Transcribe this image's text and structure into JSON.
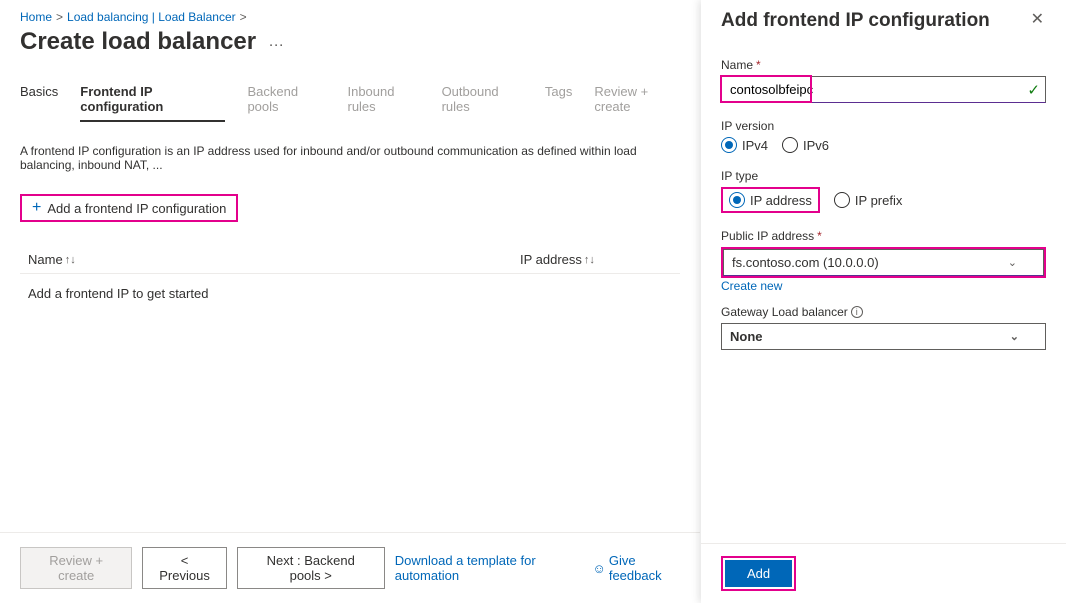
{
  "breadcrumb": {
    "items": [
      "Home",
      "Load balancing | Load Balancer"
    ]
  },
  "page": {
    "title": "Create load balancer"
  },
  "tabs": {
    "items": [
      {
        "label": "Basics"
      },
      {
        "label": "Frontend IP configuration"
      },
      {
        "label": "Backend pools"
      },
      {
        "label": "Inbound rules"
      },
      {
        "label": "Outbound rules"
      },
      {
        "label": "Tags"
      },
      {
        "label": "Review + create"
      }
    ]
  },
  "description": "A frontend IP configuration is an IP address used for inbound and/or outbound communication as defined within load balancing, inbound NAT, ...",
  "add_button": {
    "label": "Add a frontend IP configuration"
  },
  "table": {
    "headers": [
      "Name",
      "IP address"
    ],
    "empty_text": "Add a frontend IP to get started"
  },
  "footer": {
    "review": "Review + create",
    "previous": "< Previous",
    "next": "Next : Backend pools >",
    "download": "Download a template for automation",
    "feedback": "Give feedback"
  },
  "panel": {
    "title": "Add frontend IP configuration",
    "name": {
      "label": "Name",
      "value": "contosolbfeipc"
    },
    "ip_version": {
      "label": "IP version",
      "options": [
        "IPv4",
        "IPv6"
      ],
      "selected": "IPv4"
    },
    "ip_type": {
      "label": "IP type",
      "options": [
        "IP address",
        "IP prefix"
      ],
      "selected": "IP address"
    },
    "public_ip": {
      "label": "Public IP address",
      "value": "fs.contoso.com (10.0.0.0)",
      "create_new": "Create new"
    },
    "gateway": {
      "label": "Gateway Load balancer",
      "value": "None"
    },
    "add": "Add"
  }
}
